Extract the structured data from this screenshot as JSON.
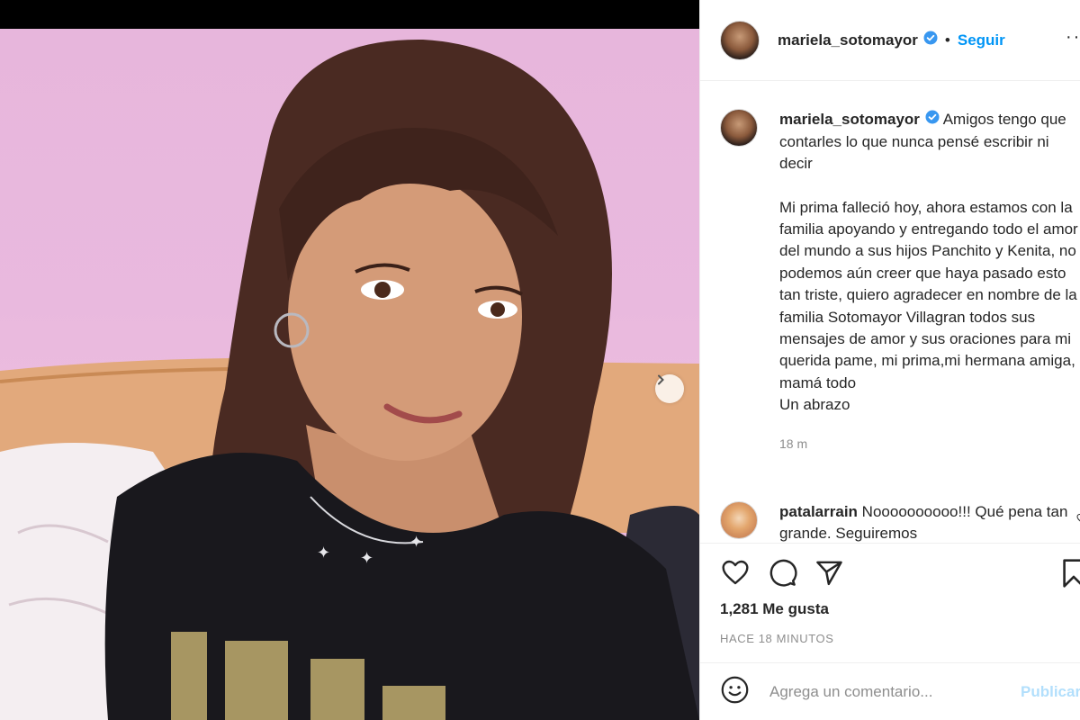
{
  "post": {
    "username": "mariela_sotomayor",
    "follow_label": "Seguir",
    "separator": "•",
    "more_label": "···",
    "caption_intro": "Amigos tengo que contarles lo que nunca pensé escribir ni decir",
    "caption_body": "Mi prima falleció hoy, ahora estamos con la familia apoyando y entregando todo el amor del mundo a sus hijos Panchito y Kenita, no podemos aún creer que haya pasado esto tan triste, quiero agradecer en nombre de la familia Sotomayor Villagran todos sus mensajes de amor y sus oraciones para mi querida pame, mi prima,mi hermana amiga, mamá todo\nUn abrazo",
    "caption_time": "18 m"
  },
  "comments": [
    {
      "username": "patalarrain",
      "text": "Noooooooooo!!! Qué pena tan grande. Seguiremos"
    }
  ],
  "actions": {
    "likes": "1,281 Me gusta",
    "posted": "HACE 18 MINUTOS"
  },
  "add_comment": {
    "placeholder": "Agrega un comentario...",
    "publish_label": "Publicar"
  },
  "carousel": {
    "slides": 2,
    "active": 1
  },
  "colors": {
    "accent": "#0095f6",
    "muted": "#8e8e8e",
    "publish_disabled": "#b2dffc"
  },
  "icons": [
    "chevron-right-icon",
    "verified-badge-icon",
    "heart-icon",
    "comment-icon",
    "share-icon",
    "bookmark-icon",
    "emoji-icon"
  ]
}
